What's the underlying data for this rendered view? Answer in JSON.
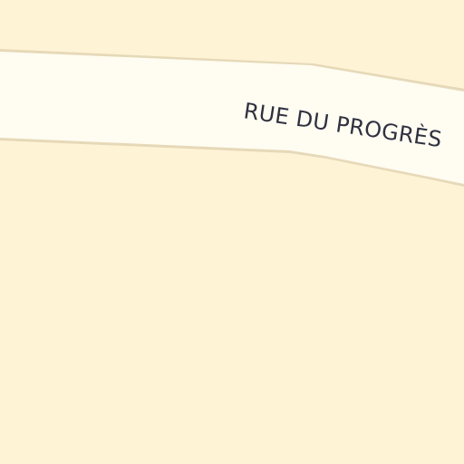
{
  "map": {
    "colors": {
      "land": "#fff3d6",
      "road_fill": "#fffcf1",
      "road_casing": "#e6d9b8",
      "adjacent_road": "#9e9ea6"
    },
    "streets": [
      {
        "label": "RUE DU PROGRÈS"
      }
    ]
  }
}
